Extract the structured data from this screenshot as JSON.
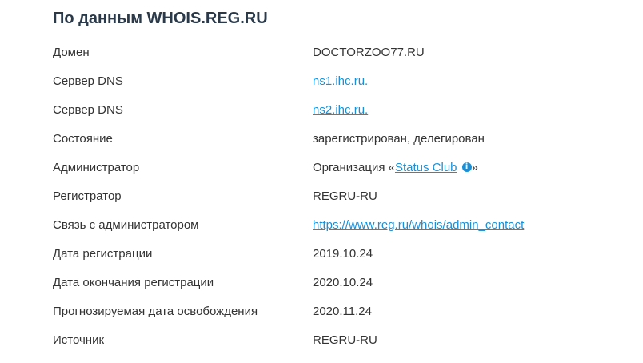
{
  "title": "По данным WHOIS.REG.RU",
  "rows": [
    {
      "label": "Домен",
      "value": "DOCTORZOO77.RU"
    },
    {
      "label": "Сервер DNS",
      "value": "ns1.ihc.ru."
    },
    {
      "label": "Сервер DNS",
      "value": "ns2.ihc.ru."
    },
    {
      "label": "Состояние",
      "value": "зарегистрирован, делегирован"
    },
    {
      "label": "Администратор",
      "prefix": "Организация «",
      "link": "Status Club",
      "suffix": "»"
    },
    {
      "label": "Регистратор",
      "value": "REGRU-RU"
    },
    {
      "label": "Связь с администратором",
      "value": "https://www.reg.ru/whois/admin_contact"
    },
    {
      "label": "Дата регистрации",
      "value": "2019.10.24"
    },
    {
      "label": "Дата окончания регистрации",
      "value": "2020.10.24"
    },
    {
      "label": "Прогнозируемая дата освобождения",
      "value": "2020.11.24"
    },
    {
      "label": "Источник",
      "value": "REGRU-RU"
    }
  ],
  "icons": {
    "info": "info-icon"
  },
  "colors": {
    "link": "#1a8fd6",
    "title": "#2b3a4a",
    "text": "#333333"
  }
}
